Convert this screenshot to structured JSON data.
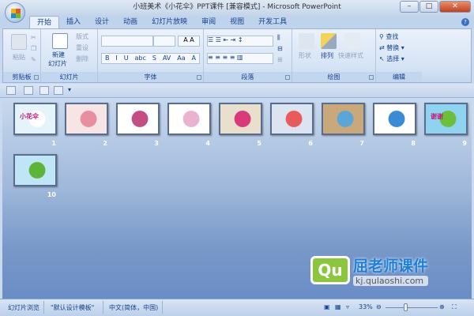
{
  "window": {
    "title": "小班美术《小花伞》PPT课件 [兼容模式] - Microsoft PowerPoint",
    "controls": [
      "minimize",
      "maximize",
      "close"
    ]
  },
  "tabs": [
    {
      "label": "开始",
      "active": true
    },
    {
      "label": "插入"
    },
    {
      "label": "设计"
    },
    {
      "label": "动画"
    },
    {
      "label": "幻灯片放映"
    },
    {
      "label": "审阅"
    },
    {
      "label": "视图"
    },
    {
      "label": "开发工具"
    }
  ],
  "ribbon": {
    "clipboard": {
      "label": "剪贴板",
      "paste": "粘贴"
    },
    "slides": {
      "label": "幻灯片",
      "new_slide": "新建",
      "new_slide2": "幻灯片",
      "layout": "版式",
      "reset": "重设",
      "delete": "删除"
    },
    "font": {
      "label": "字体",
      "font_name": "",
      "font_size": "",
      "buttons": [
        "B",
        "I",
        "U",
        "abc",
        "S",
        "AV",
        "Aa",
        "A"
      ]
    },
    "paragraph": {
      "label": "段落"
    },
    "drawing": {
      "label": "绘图",
      "shapes": "形状",
      "arrange": "排列",
      "quick_styles": "快速样式"
    },
    "editing": {
      "label": "编辑",
      "find": "查找",
      "replace": "替换",
      "select": "选择"
    }
  },
  "slides": [
    {
      "number": "1",
      "title": "小花伞",
      "colors": [
        "#e5f4fb",
        "#ffffff"
      ]
    },
    {
      "number": "2",
      "colors": [
        "#f7e4e4",
        "#e88ea0"
      ]
    },
    {
      "number": "3",
      "colors": [
        "#ffffff",
        "#c24e83"
      ]
    },
    {
      "number": "4",
      "colors": [
        "#ffffff",
        "#e9b3d0"
      ]
    },
    {
      "number": "5",
      "colors": [
        "#e8dfcc",
        "#d83a7a"
      ]
    },
    {
      "number": "6",
      "colors": [
        "#dbe4f0",
        "#e95b5b"
      ]
    },
    {
      "number": "7",
      "colors": [
        "#c9a87c",
        "#5ba6d6"
      ]
    },
    {
      "number": "8",
      "colors": [
        "#ffffff",
        "#3a8ad6"
      ]
    },
    {
      "number": "9",
      "title": "谢谢",
      "colors": [
        "#8fd3f0",
        "#6cbf3a"
      ]
    },
    {
      "number": "10",
      "colors": [
        "#bfe6f7",
        "#5cb536"
      ]
    }
  ],
  "watermark": {
    "logo": "Qu",
    "name": "屈老师课件",
    "url": "kj.qulaoshi.com"
  },
  "status": {
    "view": "幻灯片浏览",
    "theme": "\"默认设计模板\"",
    "language": "中文(简体，中国)",
    "zoom": "33%",
    "zoom_value": 33
  }
}
